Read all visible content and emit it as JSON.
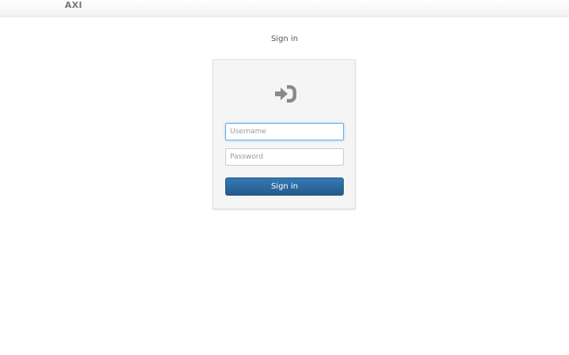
{
  "navbar": {
    "brand": "AXI"
  },
  "page": {
    "heading": "Sign in"
  },
  "form": {
    "username_placeholder": "Username",
    "username_value": "",
    "password_placeholder": "Password",
    "password_value": "",
    "submit_label": "Sign in",
    "icon": "sign-in-icon"
  },
  "colors": {
    "primary_button": "#337ab7",
    "focus_border": "#66afe9",
    "panel_background": "#f5f5f5"
  }
}
